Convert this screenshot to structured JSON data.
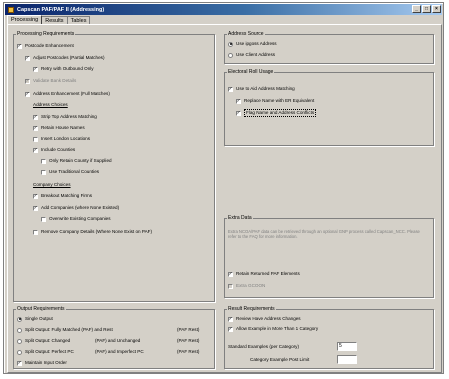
{
  "window": {
    "title": "Capscan PAF/PAF II (Addressing)"
  },
  "tabs": [
    "Processing",
    "Results",
    "Tables"
  ],
  "processing": {
    "title": "Processing Requirements",
    "items": [
      {
        "label": "Postcode Enhancement",
        "checked": true
      },
      {
        "label": "Adjust Postcodes (Partial Matches)",
        "checked": true
      },
      {
        "label": "Retry with Outbound Only",
        "checked": true
      },
      {
        "label": "Validate Bank Details",
        "checked": true
      },
      {
        "label": "Address Enhancement (Full Matches)",
        "checked": true
      },
      {
        "label": "Address Choices"
      },
      {
        "label": "Strip Top Address Matching",
        "checked": true
      },
      {
        "label": "Retain House Names",
        "checked": true
      },
      {
        "label": "Insert London Locations",
        "checked": false
      },
      {
        "label": "Include Counties",
        "checked": true
      },
      {
        "label": "Only Retain County if Supplied",
        "checked": false
      },
      {
        "label": "Use Traditional Counties",
        "checked": false
      },
      {
        "label": "Company Choices"
      },
      {
        "label": "Breakout Matching Firms",
        "checked": true
      },
      {
        "label": "Add Companies (where None Existed)",
        "checked": true
      },
      {
        "label": "Overwrite Existing Companies",
        "checked": false
      },
      {
        "label": "Remove Company Details (Where None Exist on PAF)",
        "checked": false
      }
    ]
  },
  "address_source": {
    "title": "Address Source",
    "options": [
      {
        "label": "Use ipgoss Address",
        "selected": true
      },
      {
        "label": "Use Client Address",
        "selected": false
      }
    ]
  },
  "electoral": {
    "title": "Electoral Roll Usage",
    "items": [
      {
        "label": "Use to Aid Address Matching",
        "checked": true
      },
      {
        "label": "Replace Name with ER Equivalent",
        "checked": true
      },
      {
        "label": "Flag Name and Address Conflicts",
        "checked": true
      }
    ]
  },
  "extra_data": {
    "title": "Extra Data",
    "note": "Extra NCOA/PAF data can be retrieved through an optional GNP process called Capscan_NCC. Please refer to the FAQ for more information.",
    "items": [
      {
        "label": "Retain Returned PAF Elements",
        "checked": true
      },
      {
        "label": "Extra GCOON",
        "checked": false
      }
    ]
  },
  "output": {
    "title": "Output Requirements",
    "options": [
      {
        "label": "Single Output",
        "col2": "",
        "col3": "",
        "selected": true
      },
      {
        "label": "Split Output:  Fully Matched (PAF)  and Rest",
        "col2": "",
        "col3": "(PAF Rest)",
        "selected": false
      },
      {
        "label": "Split Output:  Changed",
        "col2": "(PAF)  and Unchanged",
        "col3": "(PAF Rest)",
        "selected": false
      },
      {
        "label": "Split Output:  Perfect PC",
        "col2": "(PAF)  and Imperfect PC",
        "col3": "(PAF Rest)",
        "selected": false
      }
    ],
    "maintain": {
      "label": "Maintain Input Order",
      "checked": true
    }
  },
  "result": {
    "title": "Result Requirements",
    "items": [
      {
        "label": "Review Have Address Changes",
        "checked": true
      },
      {
        "label": "Allow Example in More Than 1 Category",
        "checked": true
      }
    ],
    "std_label": "Standard Examples (per Category)",
    "std_value": "5",
    "limit_label": "Category Example Post Limit",
    "limit_value": ""
  },
  "colors": {
    "face": "#d4d0c8",
    "title_start": "#0a246a",
    "title_end": "#a6caf0"
  }
}
